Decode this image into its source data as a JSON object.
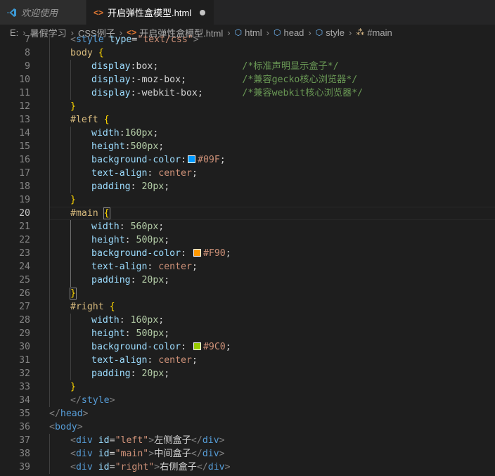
{
  "tabs": [
    {
      "label": "欢迎使用",
      "active": false
    },
    {
      "label": "开启弹性盒模型.html",
      "active": true,
      "modified": true
    }
  ],
  "breadcrumb": [
    "E:",
    "暑假学习",
    "CSS例子",
    "开启弹性盒模型.html",
    "html",
    "head",
    "style",
    "#main"
  ],
  "colors": {
    "left": "#09F",
    "main": "#F90",
    "right": "#9C0"
  },
  "lines": [
    {
      "n": "7",
      "indent": 1,
      "tokens": [
        [
          "t-punc",
          "<"
        ],
        [
          "t-tag",
          "style"
        ],
        [
          "t-text",
          " "
        ],
        [
          "t-attr",
          "type"
        ],
        [
          "t-text",
          "="
        ],
        [
          "t-str",
          "\"text/css\""
        ],
        [
          "t-punc",
          ">"
        ]
      ]
    },
    {
      "n": "8",
      "indent": 1,
      "tokens": [
        [
          "t-sel",
          "body"
        ],
        [
          "t-text",
          " "
        ],
        [
          "t-brace",
          "{"
        ]
      ]
    },
    {
      "n": "9",
      "indent": 2,
      "tokens": [
        [
          "t-prop",
          "display"
        ],
        [
          "t-text",
          ":box;               "
        ],
        [
          "t-com",
          "/*标准声明显示盒子*/"
        ]
      ]
    },
    {
      "n": "10",
      "indent": 2,
      "tokens": [
        [
          "t-prop",
          "display"
        ],
        [
          "t-text",
          ":-moz-box;          "
        ],
        [
          "t-com",
          "/*兼容gecko核心浏览器*/"
        ]
      ]
    },
    {
      "n": "11",
      "indent": 2,
      "tokens": [
        [
          "t-prop",
          "display"
        ],
        [
          "t-text",
          ":-webkit-box;       "
        ],
        [
          "t-com",
          "/*兼容webkit核心浏览器*/"
        ]
      ]
    },
    {
      "n": "12",
      "indent": 1,
      "tokens": [
        [
          "t-brace",
          "}"
        ]
      ]
    },
    {
      "n": "13",
      "indent": 1,
      "tokens": [
        [
          "t-sel",
          "#left"
        ],
        [
          "t-text",
          " "
        ],
        [
          "t-brace",
          "{"
        ]
      ]
    },
    {
      "n": "14",
      "indent": 2,
      "tokens": [
        [
          "t-prop",
          "width"
        ],
        [
          "t-text",
          ":"
        ],
        [
          "t-num",
          "160px"
        ],
        [
          "t-text",
          ";"
        ]
      ]
    },
    {
      "n": "15",
      "indent": 2,
      "tokens": [
        [
          "t-prop",
          "height"
        ],
        [
          "t-text",
          ":"
        ],
        [
          "t-num",
          "500px"
        ],
        [
          "t-text",
          ";"
        ]
      ]
    },
    {
      "n": "16",
      "indent": 2,
      "tokens": [
        [
          "t-prop",
          "background-color"
        ],
        [
          "t-text",
          ":"
        ],
        [
          "swatch",
          "left"
        ],
        [
          "t-val",
          "#09F"
        ],
        [
          "t-text",
          ";"
        ]
      ]
    },
    {
      "n": "17",
      "indent": 2,
      "tokens": [
        [
          "t-prop",
          "text-align"
        ],
        [
          "t-text",
          ": "
        ],
        [
          "t-val",
          "center"
        ],
        [
          "t-text",
          ";"
        ]
      ]
    },
    {
      "n": "18",
      "indent": 2,
      "tokens": [
        [
          "t-prop",
          "padding"
        ],
        [
          "t-text",
          ": "
        ],
        [
          "t-num",
          "20px"
        ],
        [
          "t-text",
          ";"
        ]
      ]
    },
    {
      "n": "19",
      "indent": 1,
      "tokens": [
        [
          "t-brace",
          "}"
        ]
      ]
    },
    {
      "n": "20",
      "indent": 1,
      "current": true,
      "tokens": [
        [
          "t-sel",
          "#main"
        ],
        [
          "t-text",
          " "
        ],
        [
          "t-brace-box",
          "{"
        ]
      ]
    },
    {
      "n": "21",
      "indent": 2,
      "tokens": [
        [
          "t-prop",
          "width"
        ],
        [
          "t-text",
          ": "
        ],
        [
          "t-num",
          "560px"
        ],
        [
          "t-text",
          ";"
        ]
      ]
    },
    {
      "n": "22",
      "indent": 2,
      "tokens": [
        [
          "t-prop",
          "height"
        ],
        [
          "t-text",
          ": "
        ],
        [
          "t-num",
          "500px"
        ],
        [
          "t-text",
          ";"
        ]
      ]
    },
    {
      "n": "23",
      "indent": 2,
      "tokens": [
        [
          "t-prop",
          "background-color"
        ],
        [
          "t-text",
          ": "
        ],
        [
          "swatch",
          "main"
        ],
        [
          "t-val",
          "#F90"
        ],
        [
          "t-text",
          ";"
        ]
      ]
    },
    {
      "n": "24",
      "indent": 2,
      "tokens": [
        [
          "t-prop",
          "text-align"
        ],
        [
          "t-text",
          ": "
        ],
        [
          "t-val",
          "center"
        ],
        [
          "t-text",
          ";"
        ]
      ]
    },
    {
      "n": "25",
      "indent": 2,
      "tokens": [
        [
          "t-prop",
          "padding"
        ],
        [
          "t-text",
          ": "
        ],
        [
          "t-num",
          "20px"
        ],
        [
          "t-text",
          ";"
        ]
      ]
    },
    {
      "n": "26",
      "indent": 1,
      "tokens": [
        [
          "t-brace-box",
          "}"
        ]
      ]
    },
    {
      "n": "27",
      "indent": 1,
      "tokens": [
        [
          "t-sel",
          "#right"
        ],
        [
          "t-text",
          " "
        ],
        [
          "t-brace",
          "{"
        ]
      ]
    },
    {
      "n": "28",
      "indent": 2,
      "tokens": [
        [
          "t-prop",
          "width"
        ],
        [
          "t-text",
          ": "
        ],
        [
          "t-num",
          "160px"
        ],
        [
          "t-text",
          ";"
        ]
      ]
    },
    {
      "n": "29",
      "indent": 2,
      "tokens": [
        [
          "t-prop",
          "height"
        ],
        [
          "t-text",
          ": "
        ],
        [
          "t-num",
          "500px"
        ],
        [
          "t-text",
          ";"
        ]
      ]
    },
    {
      "n": "30",
      "indent": 2,
      "tokens": [
        [
          "t-prop",
          "background-color"
        ],
        [
          "t-text",
          ": "
        ],
        [
          "swatch",
          "right"
        ],
        [
          "t-val",
          "#9C0"
        ],
        [
          "t-text",
          ";"
        ]
      ]
    },
    {
      "n": "31",
      "indent": 2,
      "tokens": [
        [
          "t-prop",
          "text-align"
        ],
        [
          "t-text",
          ": "
        ],
        [
          "t-val",
          "center"
        ],
        [
          "t-text",
          ";"
        ]
      ]
    },
    {
      "n": "32",
      "indent": 2,
      "tokens": [
        [
          "t-prop",
          "padding"
        ],
        [
          "t-text",
          ": "
        ],
        [
          "t-num",
          "20px"
        ],
        [
          "t-text",
          ";"
        ]
      ]
    },
    {
      "n": "33",
      "indent": 1,
      "tokens": [
        [
          "t-brace",
          "}"
        ]
      ]
    },
    {
      "n": "34",
      "indent": 1,
      "tokens": [
        [
          "t-punc",
          "</"
        ],
        [
          "t-tag",
          "style"
        ],
        [
          "t-punc",
          ">"
        ]
      ]
    },
    {
      "n": "35",
      "indent": 0,
      "tokens": [
        [
          "t-punc",
          "</"
        ],
        [
          "t-tag",
          "head"
        ],
        [
          "t-punc",
          ">"
        ]
      ]
    },
    {
      "n": "36",
      "indent": 0,
      "tokens": [
        [
          "t-punc",
          "<"
        ],
        [
          "t-tag",
          "body"
        ],
        [
          "t-punc",
          ">"
        ]
      ]
    },
    {
      "n": "37",
      "indent": 1,
      "tokens": [
        [
          "t-punc",
          "<"
        ],
        [
          "t-tag",
          "div"
        ],
        [
          "t-text",
          " "
        ],
        [
          "t-attr",
          "id"
        ],
        [
          "t-text",
          "="
        ],
        [
          "t-str",
          "\"left\""
        ],
        [
          "t-punc",
          ">"
        ],
        [
          "t-text",
          "左侧盒子"
        ],
        [
          "t-punc",
          "</"
        ],
        [
          "t-tag",
          "div"
        ],
        [
          "t-punc",
          ">"
        ]
      ]
    },
    {
      "n": "38",
      "indent": 1,
      "tokens": [
        [
          "t-punc",
          "<"
        ],
        [
          "t-tag",
          "div"
        ],
        [
          "t-text",
          " "
        ],
        [
          "t-attr",
          "id"
        ],
        [
          "t-text",
          "="
        ],
        [
          "t-str",
          "\"main\""
        ],
        [
          "t-punc",
          ">"
        ],
        [
          "t-text",
          "中间盒子"
        ],
        [
          "t-punc",
          "</"
        ],
        [
          "t-tag",
          "div"
        ],
        [
          "t-punc",
          ">"
        ]
      ]
    },
    {
      "n": "39",
      "indent": 1,
      "tokens": [
        [
          "t-punc",
          "<"
        ],
        [
          "t-tag",
          "div"
        ],
        [
          "t-text",
          " "
        ],
        [
          "t-attr",
          "id"
        ],
        [
          "t-text",
          "="
        ],
        [
          "t-str",
          "\"right\""
        ],
        [
          "t-punc",
          ">"
        ],
        [
          "t-text",
          "右侧盒子"
        ],
        [
          "t-punc",
          "</"
        ],
        [
          "t-tag",
          "div"
        ],
        [
          "t-punc",
          ">"
        ]
      ]
    }
  ]
}
